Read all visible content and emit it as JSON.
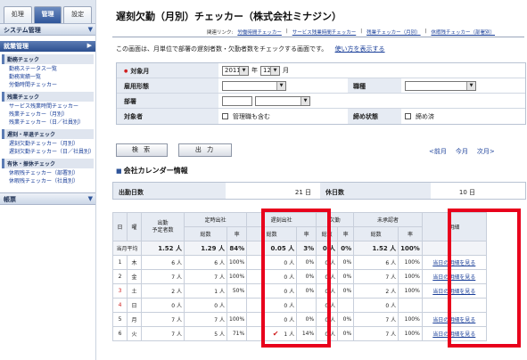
{
  "sidebar": {
    "tabs": [
      "処理",
      "管理",
      "設定"
    ],
    "system_head": "システム管理",
    "work_head": "就業管理",
    "groups": [
      {
        "title": "勤務チェック",
        "links": [
          "勤務ステータス一覧",
          "勤務実績一覧",
          "労働時間チェッカー"
        ]
      },
      {
        "title": "残業チェック",
        "links": [
          "サービス残業時間チェッカー",
          "残業チェッカー（月別）",
          "残業チェッカー（日／社員別）"
        ]
      },
      {
        "title": "遅刻・早退チェック",
        "links": [
          "遅刻欠勤チェッカー（月別）",
          "遅刻欠勤チェッカー（日／社員別）"
        ]
      },
      {
        "title": "有休・振休チェック",
        "links": [
          "休暇残チェッカー（部署別）",
          "休暇残チェッカー（社員別）"
        ]
      }
    ],
    "ledger_head": "帳票"
  },
  "header": {
    "title": "遅刻欠勤（月別）チェッカー（株式会社ミナジン）",
    "related_label": "関連リンク:",
    "related_links": [
      "労働時間チェッカー",
      "サービス残業時間チェッカー",
      "残業チェッカー（月別）",
      "休暇残チェッカー（部署別）"
    ],
    "intro": "この画面は、月単位で部署の遅刻者数・欠勤者数をチェックする画面です。",
    "howto_link": "使い方を表示する"
  },
  "form": {
    "month_label": "対象月",
    "year_value": "2011",
    "year_unit": "年",
    "month_value": "12",
    "month_unit": "月",
    "employment_label": "雇用形態",
    "position_label": "職種",
    "dept_label": "部署",
    "target_label": "対象者",
    "manager_checkbox": "管理職も含む",
    "closing_label": "締め状態",
    "closed_checkbox": "締め済"
  },
  "buttons": {
    "search": "検 索",
    "output": "出 力"
  },
  "month_nav": {
    "prev": "<前月",
    "current": "今月",
    "next": "次月>"
  },
  "calendar": {
    "title": "会社カレンダー情報",
    "work_days_label": "出勤日数",
    "work_days_value": "21 日",
    "holidays_label": "休日数",
    "holidays_value": "10 日"
  },
  "table": {
    "headers": {
      "day": "日",
      "weekday": "曜",
      "scheduled": "出勤\n予定者数",
      "regular": "定時出社",
      "late": "遅刻出社",
      "absent": "欠勤",
      "unapproved": "未承認者",
      "detail": "明細",
      "total": "総数",
      "rate": "率"
    },
    "average": {
      "label": "当月平均",
      "scheduled": "1.52 人",
      "regular_total": "1.29 人",
      "regular_rate": "84%",
      "late_total": "0.05 人",
      "late_rate": "3%",
      "absent_total": "0 人",
      "absent_rate": "0%",
      "unap_total": "1.52 人",
      "unap_rate": "100%"
    },
    "rows": [
      {
        "day": "1",
        "wd": "木",
        "sched": "6 人",
        "reg": "6 人",
        "reg_rate": "100%",
        "late": "0 人",
        "late_rate": "0%",
        "abs": "0 人",
        "abs_rate": "0%",
        "unap": "6 人",
        "unap_rate": "100%",
        "detail": "当日の明細を見る",
        "kind": ""
      },
      {
        "day": "2",
        "wd": "金",
        "sched": "7 人",
        "reg": "7 人",
        "reg_rate": "100%",
        "late": "0 人",
        "late_rate": "0%",
        "abs": "0 人",
        "abs_rate": "0%",
        "unap": "7 人",
        "unap_rate": "100%",
        "detail": "当日の明細を見る",
        "kind": ""
      },
      {
        "day": "3",
        "wd": "土",
        "sched": "2 人",
        "reg": "1 人",
        "reg_rate": "50%",
        "late": "0 人",
        "late_rate": "0%",
        "abs": "0 人",
        "abs_rate": "0%",
        "unap": "2 人",
        "unap_rate": "100%",
        "detail": "当日の明細を見る",
        "kind": "sat"
      },
      {
        "day": "4",
        "wd": "日",
        "sched": "0 人",
        "reg": "0 人",
        "reg_rate": "",
        "late": "0 人",
        "late_rate": "",
        "abs": "0 人",
        "abs_rate": "",
        "unap": "0 人",
        "unap_rate": "",
        "detail": "",
        "kind": "sun"
      },
      {
        "day": "5",
        "wd": "月",
        "sched": "7 人",
        "reg": "7 人",
        "reg_rate": "100%",
        "late": "0 人",
        "late_rate": "0%",
        "abs": "0 人",
        "abs_rate": "0%",
        "unap": "7 人",
        "unap_rate": "100%",
        "detail": "当日の明細を見る",
        "kind": ""
      },
      {
        "day": "6",
        "wd": "火",
        "sched": "7 人",
        "reg": "5 人",
        "reg_rate": "71%",
        "late": "1 人",
        "late_rate": "14%",
        "abs": "0 人",
        "abs_rate": "0%",
        "unap": "7 人",
        "unap_rate": "100%",
        "detail": "当日の明細を見る",
        "kind": ""
      }
    ]
  },
  "colors": {
    "highlight": "#e8001c",
    "accent": "#2f559a",
    "link": "#1a3f99"
  }
}
